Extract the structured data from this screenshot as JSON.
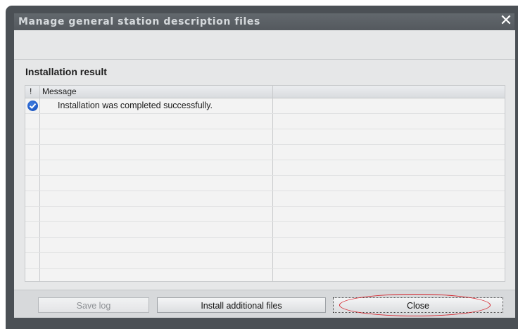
{
  "window": {
    "title": "Manage general station description files",
    "close_glyph": "✕"
  },
  "section": {
    "title": "Installation result"
  },
  "table": {
    "columns": [
      "!",
      "Message",
      ""
    ],
    "rows": [
      {
        "icon": "check-circle-icon",
        "message": "Installation was completed successfully."
      }
    ]
  },
  "buttons": {
    "save_log": "Save log",
    "install_additional": "Install additional files",
    "close": "Close"
  },
  "colors": {
    "highlight_ring": "#d5222a",
    "success_icon": "#1a56c8"
  }
}
